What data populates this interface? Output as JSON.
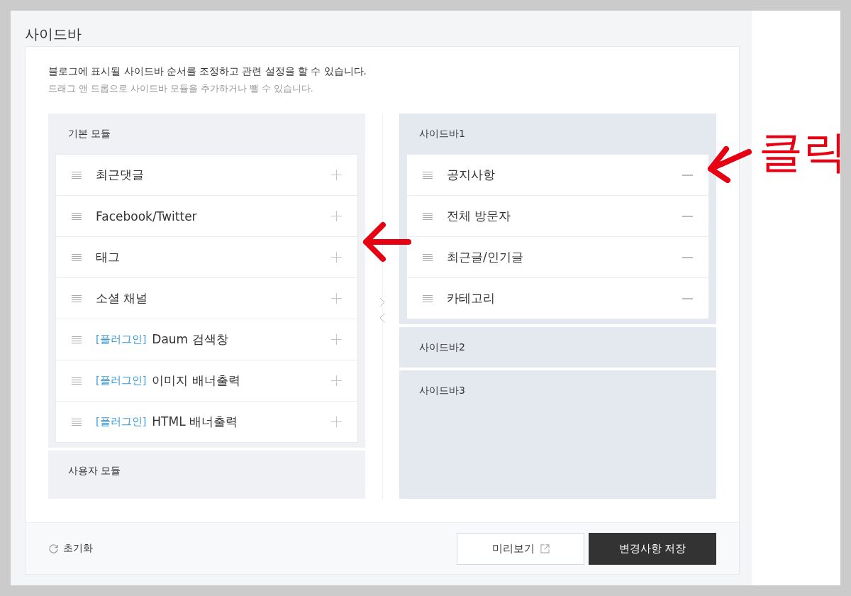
{
  "page_title": "사이드바",
  "description": "블로그에 표시될 사이드바 순서를 조정하고 관련 설정을 할 수 있습니다.",
  "hint": "드래그 앤 드롭으로 사이드바 모듈을 추가하거나 뺄 수 있습니다.",
  "module_groups": [
    {
      "title": "기본 모듈",
      "kind": "add",
      "items": [
        {
          "label": "최근댓글"
        },
        {
          "label": "Facebook/Twitter"
        },
        {
          "label": "태그"
        },
        {
          "label": "소셜 채널"
        },
        {
          "tag": "[플러그인]",
          "label": "Daum 검색창"
        },
        {
          "tag": "[플러그인]",
          "label": "이미지 배너출력"
        },
        {
          "tag": "[플러그인]",
          "label": "HTML 배너출력"
        }
      ]
    },
    {
      "title": "사용자 모듈"
    }
  ],
  "sidebars": [
    {
      "title": "사이드바1",
      "kind": "remove",
      "items": [
        {
          "label": "공지사항"
        },
        {
          "label": "전체 방문자"
        },
        {
          "label": "최근글/인기글"
        },
        {
          "label": "카테고리"
        }
      ]
    },
    {
      "title": "사이드바2"
    },
    {
      "title": "사이드바3"
    }
  ],
  "footer": {
    "reset": "초기화",
    "preview": "미리보기",
    "save": "변경사항 저장"
  },
  "annotation": {
    "text": "클릭"
  }
}
